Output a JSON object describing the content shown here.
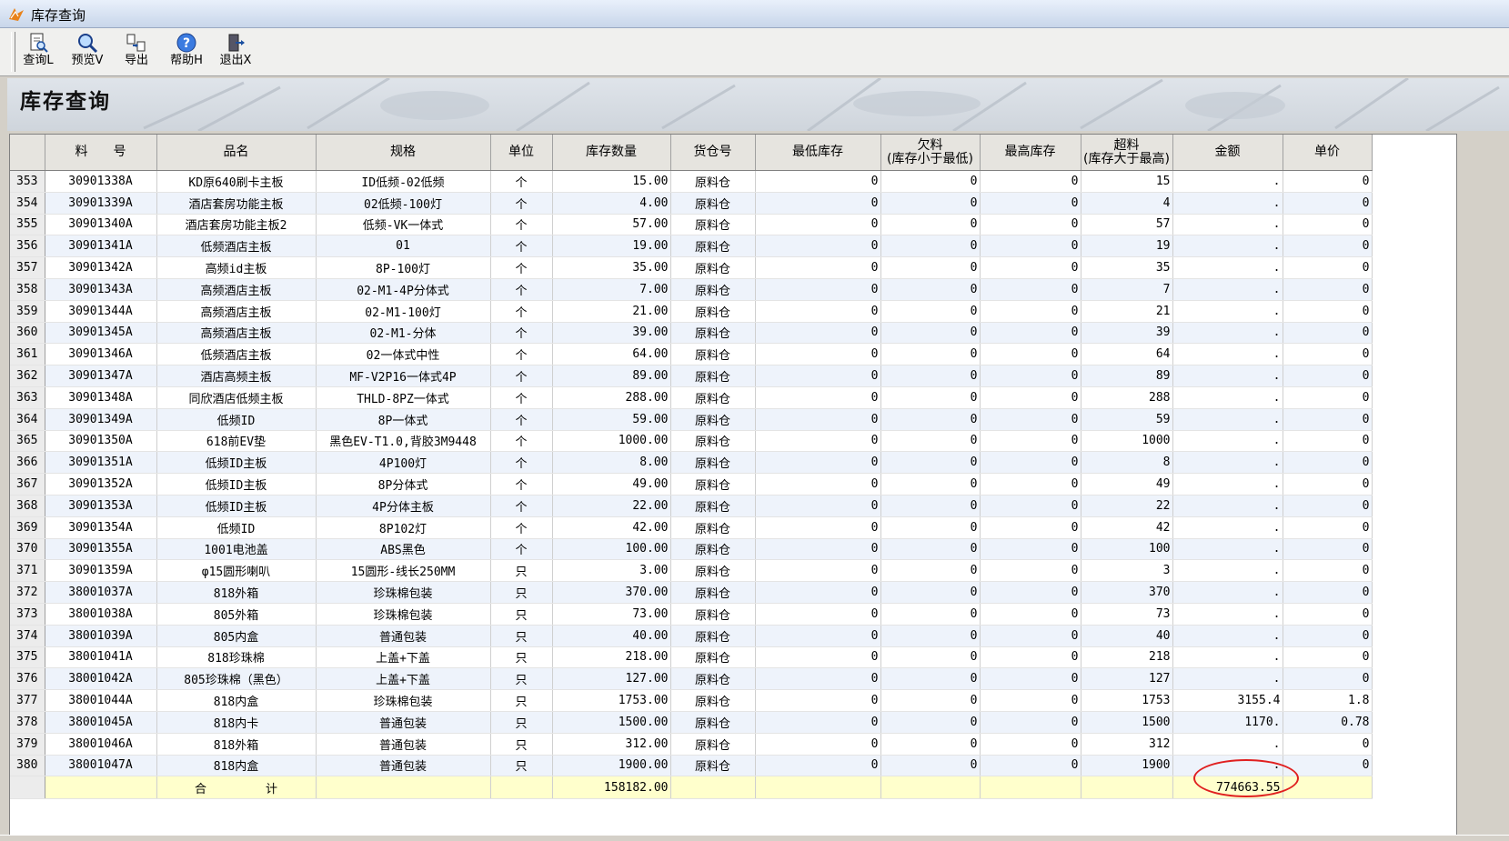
{
  "window": {
    "title": "库存查询"
  },
  "toolbar": [
    {
      "label": "查询L",
      "icon": "query-doc-icon"
    },
    {
      "label": "预览V",
      "icon": "magnifier-icon"
    },
    {
      "label": "导出",
      "icon": "export-icon"
    },
    {
      "label": "帮助H",
      "icon": "help-icon"
    },
    {
      "label": "退出X",
      "icon": "exit-icon"
    }
  ],
  "banner": {
    "title": "库存查询"
  },
  "columns": [
    "",
    "料　　号",
    "品名",
    "规格",
    "单位",
    "库存数量",
    "货仓号",
    "最低库存",
    "欠料\n(库存小于最低)",
    "最高库存",
    "超料\n(库存大于最高)",
    "金额",
    "单价"
  ],
  "rows": [
    [
      "353",
      "30901338A",
      "KD原640刷卡主板",
      "ID低频-02低频",
      "个",
      "15.00",
      "原料仓",
      "0",
      "0",
      "0",
      "15",
      ".",
      "0"
    ],
    [
      "354",
      "30901339A",
      "酒店套房功能主板",
      "02低频-100灯",
      "个",
      "4.00",
      "原料仓",
      "0",
      "0",
      "0",
      "4",
      ".",
      "0"
    ],
    [
      "355",
      "30901340A",
      "酒店套房功能主板2",
      "低频-VK一体式",
      "个",
      "57.00",
      "原料仓",
      "0",
      "0",
      "0",
      "57",
      ".",
      "0"
    ],
    [
      "356",
      "30901341A",
      "低频酒店主板",
      "01",
      "个",
      "19.00",
      "原料仓",
      "0",
      "0",
      "0",
      "19",
      ".",
      "0"
    ],
    [
      "357",
      "30901342A",
      "高频id主板",
      "8P-100灯",
      "个",
      "35.00",
      "原料仓",
      "0",
      "0",
      "0",
      "35",
      ".",
      "0"
    ],
    [
      "358",
      "30901343A",
      "高频酒店主板",
      "02-M1-4P分体式",
      "个",
      "7.00",
      "原料仓",
      "0",
      "0",
      "0",
      "7",
      ".",
      "0"
    ],
    [
      "359",
      "30901344A",
      "高频酒店主板",
      "02-M1-100灯",
      "个",
      "21.00",
      "原料仓",
      "0",
      "0",
      "0",
      "21",
      ".",
      "0"
    ],
    [
      "360",
      "30901345A",
      "高频酒店主板",
      "02-M1-分体",
      "个",
      "39.00",
      "原料仓",
      "0",
      "0",
      "0",
      "39",
      ".",
      "0"
    ],
    [
      "361",
      "30901346A",
      "低频酒店主板",
      "02一体式中性",
      "个",
      "64.00",
      "原料仓",
      "0",
      "0",
      "0",
      "64",
      ".",
      "0"
    ],
    [
      "362",
      "30901347A",
      "酒店高频主板",
      "MF-V2P16一体式4P",
      "个",
      "89.00",
      "原料仓",
      "0",
      "0",
      "0",
      "89",
      ".",
      "0"
    ],
    [
      "363",
      "30901348A",
      "同欣酒店低频主板",
      "THLD-8PZ一体式",
      "个",
      "288.00",
      "原料仓",
      "0",
      "0",
      "0",
      "288",
      ".",
      "0"
    ],
    [
      "364",
      "30901349A",
      "低频ID",
      "8P一体式",
      "个",
      "59.00",
      "原料仓",
      "0",
      "0",
      "0",
      "59",
      ".",
      "0"
    ],
    [
      "365",
      "30901350A",
      "618前EV垫",
      "黑色EV-T1.0,背胶3M9448",
      "个",
      "1000.00",
      "原料仓",
      "0",
      "0",
      "0",
      "1000",
      ".",
      "0"
    ],
    [
      "366",
      "30901351A",
      "低频ID主板",
      "4P100灯",
      "个",
      "8.00",
      "原料仓",
      "0",
      "0",
      "0",
      "8",
      ".",
      "0"
    ],
    [
      "367",
      "30901352A",
      "低频ID主板",
      "8P分体式",
      "个",
      "49.00",
      "原料仓",
      "0",
      "0",
      "0",
      "49",
      ".",
      "0"
    ],
    [
      "368",
      "30901353A",
      "低频ID主板",
      "4P分体主板",
      "个",
      "22.00",
      "原料仓",
      "0",
      "0",
      "0",
      "22",
      ".",
      "0"
    ],
    [
      "369",
      "30901354A",
      "低频ID",
      "8P102灯",
      "个",
      "42.00",
      "原料仓",
      "0",
      "0",
      "0",
      "42",
      ".",
      "0"
    ],
    [
      "370",
      "30901355A",
      "1001电池盖",
      "ABS黑色",
      "个",
      "100.00",
      "原料仓",
      "0",
      "0",
      "0",
      "100",
      ".",
      "0"
    ],
    [
      "371",
      "30901359A",
      "φ15圆形喇叭",
      "15圆形-线长250MM",
      "只",
      "3.00",
      "原料仓",
      "0",
      "0",
      "0",
      "3",
      ".",
      "0"
    ],
    [
      "372",
      "38001037A",
      "818外箱",
      "珍珠棉包装",
      "只",
      "370.00",
      "原料仓",
      "0",
      "0",
      "0",
      "370",
      ".",
      "0"
    ],
    [
      "373",
      "38001038A",
      "805外箱",
      "珍珠棉包装",
      "只",
      "73.00",
      "原料仓",
      "0",
      "0",
      "0",
      "73",
      ".",
      "0"
    ],
    [
      "374",
      "38001039A",
      "805内盒",
      "普通包装",
      "只",
      "40.00",
      "原料仓",
      "0",
      "0",
      "0",
      "40",
      ".",
      "0"
    ],
    [
      "375",
      "38001041A",
      "818珍珠棉",
      "上盖+下盖",
      "只",
      "218.00",
      "原料仓",
      "0",
      "0",
      "0",
      "218",
      ".",
      "0"
    ],
    [
      "376",
      "38001042A",
      "805珍珠棉（黑色）",
      "上盖+下盖",
      "只",
      "127.00",
      "原料仓",
      "0",
      "0",
      "0",
      "127",
      ".",
      "0"
    ],
    [
      "377",
      "38001044A",
      "818内盒",
      "珍珠棉包装",
      "只",
      "1753.00",
      "原料仓",
      "0",
      "0",
      "0",
      "1753",
      "3155.4",
      "1.8"
    ],
    [
      "378",
      "38001045A",
      "818内卡",
      "普通包装",
      "只",
      "1500.00",
      "原料仓",
      "0",
      "0",
      "0",
      "1500",
      "1170.",
      "0.78"
    ],
    [
      "379",
      "38001046A",
      "818外箱",
      "普通包装",
      "只",
      "312.00",
      "原料仓",
      "0",
      "0",
      "0",
      "312",
      ".",
      "0"
    ],
    [
      "380",
      "38001047A",
      "818内盒",
      "普通包装",
      "只",
      "1900.00",
      "原料仓",
      "0",
      "0",
      "0",
      "1900",
      ".",
      "0"
    ]
  ],
  "total": {
    "label": "合　　　　　计",
    "qty": "158182.00",
    "amount": "774663.55"
  },
  "colors": {
    "header_bg": "#e6e4df",
    "row_alt": "#eef3fb",
    "total_bg": "#ffffcc",
    "highlight_oval": "#e02020"
  }
}
